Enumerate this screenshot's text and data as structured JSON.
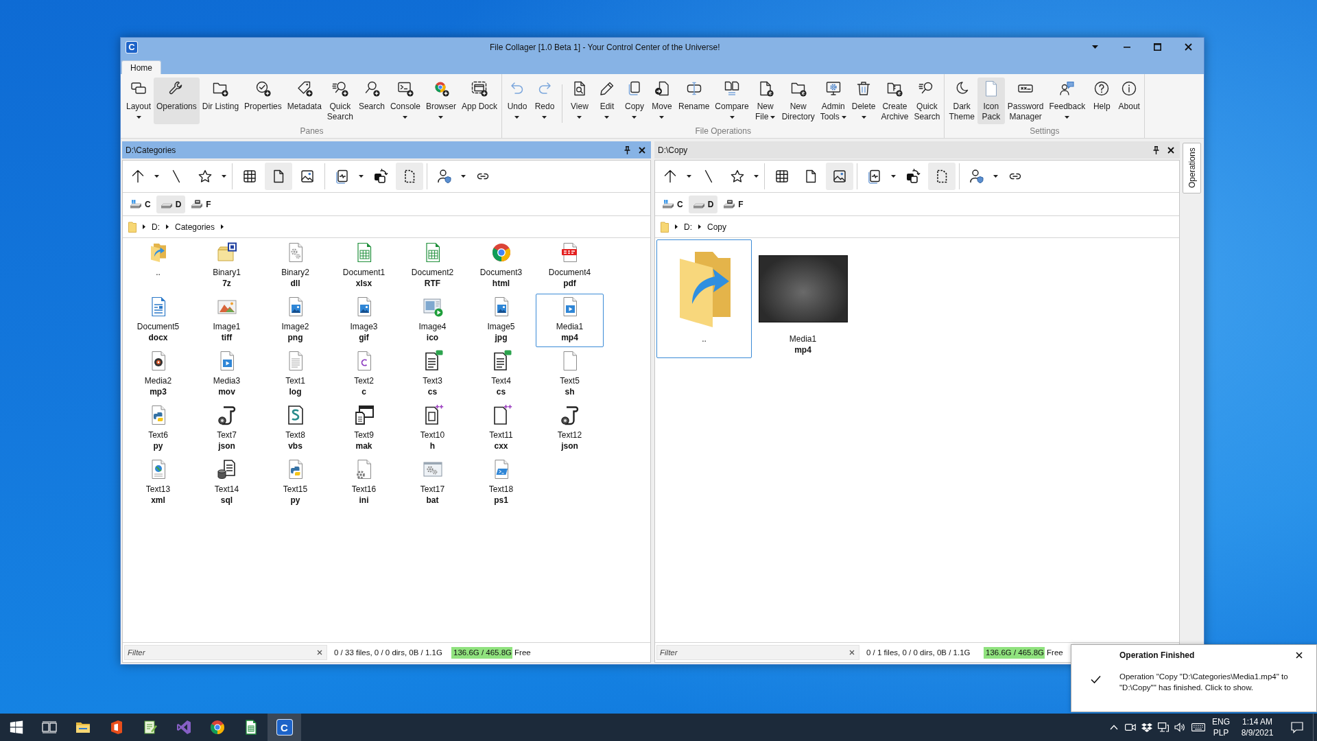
{
  "window": {
    "logo": "C",
    "title": "File Collager [1.0 Beta 1] - Your Control Center of the Universe!",
    "tabs": [
      {
        "label": "Home",
        "selected": true
      }
    ]
  },
  "ribbon": [
    {
      "label": "Panes",
      "buttons": [
        {
          "label": "Layout",
          "dropdown": true,
          "active": false
        },
        {
          "label": "Operations",
          "dropdown": false,
          "active": true
        },
        {
          "label": "Dir Listing",
          "dropdown": false,
          "active": false
        },
        {
          "label": "Properties",
          "dropdown": false,
          "active": false
        },
        {
          "label": "Metadata",
          "dropdown": false,
          "active": false
        },
        {
          "label": "Quick Search",
          "dropdown": false,
          "active": false
        },
        {
          "label": "Search",
          "dropdown": false,
          "active": false
        },
        {
          "label": "Console",
          "dropdown": true,
          "active": false
        },
        {
          "label": "Browser",
          "dropdown": true,
          "active": false
        },
        {
          "label": "App Dock",
          "dropdown": false,
          "active": false
        }
      ]
    },
    {
      "label": "File Operations",
      "buttons": [
        {
          "label": "Undo",
          "dropdown": true,
          "active": false
        },
        {
          "label": "Redo",
          "dropdown": true,
          "active": false
        },
        {
          "label": "View",
          "dropdown": true,
          "active": false
        },
        {
          "label": "Edit",
          "dropdown": true,
          "active": false
        },
        {
          "label": "Copy",
          "dropdown": true,
          "active": false
        },
        {
          "label": "Move",
          "dropdown": true,
          "active": false
        },
        {
          "label": "Rename",
          "dropdown": false,
          "active": false
        },
        {
          "label": "Compare",
          "dropdown": true,
          "active": false
        },
        {
          "label": "New File",
          "dropdown": true,
          "active": false
        },
        {
          "label": "New Directory",
          "dropdown": false,
          "active": false
        },
        {
          "label": "Admin Tools",
          "dropdown": true,
          "active": false
        },
        {
          "label": "Delete",
          "dropdown": true,
          "active": false
        },
        {
          "label": "Create Archive",
          "dropdown": false,
          "active": false
        },
        {
          "label": "Quick Search",
          "dropdown": false,
          "active": false
        }
      ]
    },
    {
      "label": "Settings",
      "buttons": [
        {
          "label": "Dark Theme",
          "dropdown": false,
          "active": false
        },
        {
          "label": "Icon Pack",
          "dropdown": false,
          "active": true
        },
        {
          "label": "Password Manager",
          "dropdown": false,
          "active": false
        },
        {
          "label": "Feedback",
          "dropdown": true,
          "active": false
        },
        {
          "label": "Help",
          "dropdown": false,
          "active": false
        },
        {
          "label": "About",
          "dropdown": false,
          "active": false
        }
      ]
    }
  ],
  "panes": [
    {
      "title": "D:\\Categories",
      "focused": true,
      "toolbar": [
        {
          "dropdown": true,
          "active": false
        },
        {
          "dropdown": false,
          "active": false
        },
        {
          "dropdown": true,
          "active": false
        },
        {
          "dropdown": false,
          "active": false
        },
        {
          "dropdown": false,
          "active": true
        },
        {
          "dropdown": false,
          "active": false
        },
        {
          "dropdown": true,
          "active": false
        },
        {
          "dropdown": false,
          "active": false
        },
        {
          "dropdown": false,
          "active": true
        },
        {
          "dropdown": true,
          "active": false
        },
        {
          "dropdown": false,
          "active": false
        }
      ],
      "drives": [
        {
          "label": "C",
          "selected": false
        },
        {
          "label": "D",
          "selected": true
        },
        {
          "label": "F",
          "selected": false
        }
      ],
      "breadcrumb": [
        {
          "label": "D:",
          "expandable": true
        },
        {
          "label": "Categories",
          "expandable": true
        }
      ],
      "items": [
        {
          "name": "..",
          "kind": "parent",
          "selected": false
        },
        {
          "name": "Binary1",
          "ext": "7z",
          "kind": "archive",
          "selected": false
        },
        {
          "name": "Binary2",
          "ext": "dll",
          "kind": "library",
          "selected": false
        },
        {
          "name": "Document1",
          "ext": "xlsx",
          "kind": "spreadsheet",
          "selected": false
        },
        {
          "name": "Document2",
          "ext": "RTF",
          "kind": "spreadsheet",
          "selected": false
        },
        {
          "name": "Document3",
          "ext": "html",
          "kind": "web",
          "selected": false
        },
        {
          "name": "Document4",
          "ext": "pdf",
          "kind": "pdf",
          "selected": false
        },
        {
          "name": "Document5",
          "ext": "docx",
          "kind": "writer",
          "selected": false
        },
        {
          "name": "Image1",
          "ext": "tiff",
          "kind": "painting",
          "selected": false
        },
        {
          "name": "Image2",
          "ext": "png",
          "kind": "image",
          "selected": false
        },
        {
          "name": "Image3",
          "ext": "gif",
          "kind": "image",
          "selected": false
        },
        {
          "name": "Image4",
          "ext": "ico",
          "kind": "slideshow",
          "selected": false
        },
        {
          "name": "Image5",
          "ext": "jpg",
          "kind": "image",
          "selected": false
        },
        {
          "name": "Media1",
          "ext": "mp4",
          "kind": "video",
          "selected": true
        },
        {
          "name": "Media2",
          "ext": "mp3",
          "kind": "audio",
          "selected": false
        },
        {
          "name": "Media3",
          "ext": "mov",
          "kind": "video",
          "selected": false
        },
        {
          "name": "Text1",
          "ext": "log",
          "kind": "text",
          "selected": false
        },
        {
          "name": "Text2",
          "ext": "c",
          "kind": "c",
          "selected": false
        },
        {
          "name": "Text3",
          "ext": "cs",
          "kind": "csharp",
          "selected": false
        },
        {
          "name": "Text4",
          "ext": "cs",
          "kind": "csharp",
          "selected": false
        },
        {
          "name": "Text5",
          "ext": "sh",
          "kind": "blank",
          "selected": false
        },
        {
          "name": "Text6",
          "ext": "py",
          "kind": "python",
          "selected": false
        },
        {
          "name": "Text7",
          "ext": "json",
          "kind": "json",
          "selected": false
        },
        {
          "name": "Text8",
          "ext": "vbs",
          "kind": "vbscript",
          "selected": false
        },
        {
          "name": "Text9",
          "ext": "mak",
          "kind": "makefile",
          "selected": false
        },
        {
          "name": "Text10",
          "ext": "h",
          "kind": "header",
          "selected": false
        },
        {
          "name": "Text11",
          "ext": "cxx",
          "kind": "cpp",
          "selected": false
        },
        {
          "name": "Text12",
          "ext": "json",
          "kind": "json",
          "selected": false
        },
        {
          "name": "Text13",
          "ext": "xml",
          "kind": "xml",
          "selected": false
        },
        {
          "name": "Text14",
          "ext": "sql",
          "kind": "sql",
          "selected": false
        },
        {
          "name": "Text15",
          "ext": "py",
          "kind": "python",
          "selected": false
        },
        {
          "name": "Text16",
          "ext": "ini",
          "kind": "settings",
          "selected": false
        },
        {
          "name": "Text17",
          "ext": "bat",
          "kind": "batch",
          "selected": false
        },
        {
          "name": "Text18",
          "ext": "ps1",
          "kind": "powershell",
          "selected": false
        }
      ],
      "status": {
        "filter": {
          "placeholder": "Filter"
        },
        "summary": "0 / 33 files, 0 / 0 dirs, 0B / 1.1G",
        "disk": {
          "reading": "136.6G / 465.8G",
          "label": "Free",
          "level": 0.74
        }
      }
    },
    {
      "title": "D:\\Copy",
      "focused": false,
      "toolbar": [
        {
          "dropdown": true,
          "active": false
        },
        {
          "dropdown": false,
          "active": false
        },
        {
          "dropdown": true,
          "active": false
        },
        {
          "dropdown": false,
          "active": false
        },
        {
          "dropdown": false,
          "active": false
        },
        {
          "dropdown": false,
          "active": true
        },
        {
          "dropdown": true,
          "active": false
        },
        {
          "dropdown": false,
          "active": false
        },
        {
          "dropdown": false,
          "active": true
        },
        {
          "dropdown": true,
          "active": false
        },
        {
          "dropdown": false,
          "active": false
        }
      ],
      "drives": [
        {
          "label": "C",
          "selected": false
        },
        {
          "label": "D",
          "selected": true
        },
        {
          "label": "F",
          "selected": false
        }
      ],
      "breadcrumb": [
        {
          "label": "D:",
          "expandable": true
        },
        {
          "label": "Copy",
          "expandable": false
        }
      ],
      "items": [
        {
          "name": "..",
          "kind": "parent",
          "selected": true
        },
        {
          "name": "Media1",
          "ext": "mp4",
          "kind": "video",
          "selected": false
        }
      ],
      "status": {
        "filter": {
          "placeholder": "Filter"
        },
        "summary": "0 / 1 files, 0 / 0 dirs, 0B / 1.1G",
        "disk": {
          "reading": "136.6G / 465.8G",
          "label": "Free",
          "level": 0.74
        }
      }
    }
  ],
  "side_tabs": [
    {
      "label": "Operations"
    }
  ],
  "notification": {
    "title": "Operation Finished",
    "message": "Operation \"Copy \"D:\\Categories\\Media1.mp4\" to \"D:\\Copy\"\" has finished. Click to show."
  },
  "taskbar": {
    "apps": [
      {
        "selected": false
      },
      {
        "selected": false
      },
      {
        "selected": false
      },
      {
        "selected": false
      },
      {
        "selected": false
      },
      {
        "selected": false
      },
      {
        "logo": "C",
        "selected": true
      }
    ],
    "language": "ENG",
    "keyboard_layout": "PLP",
    "time": "1:14 AM",
    "date": "8/9/2021"
  }
}
